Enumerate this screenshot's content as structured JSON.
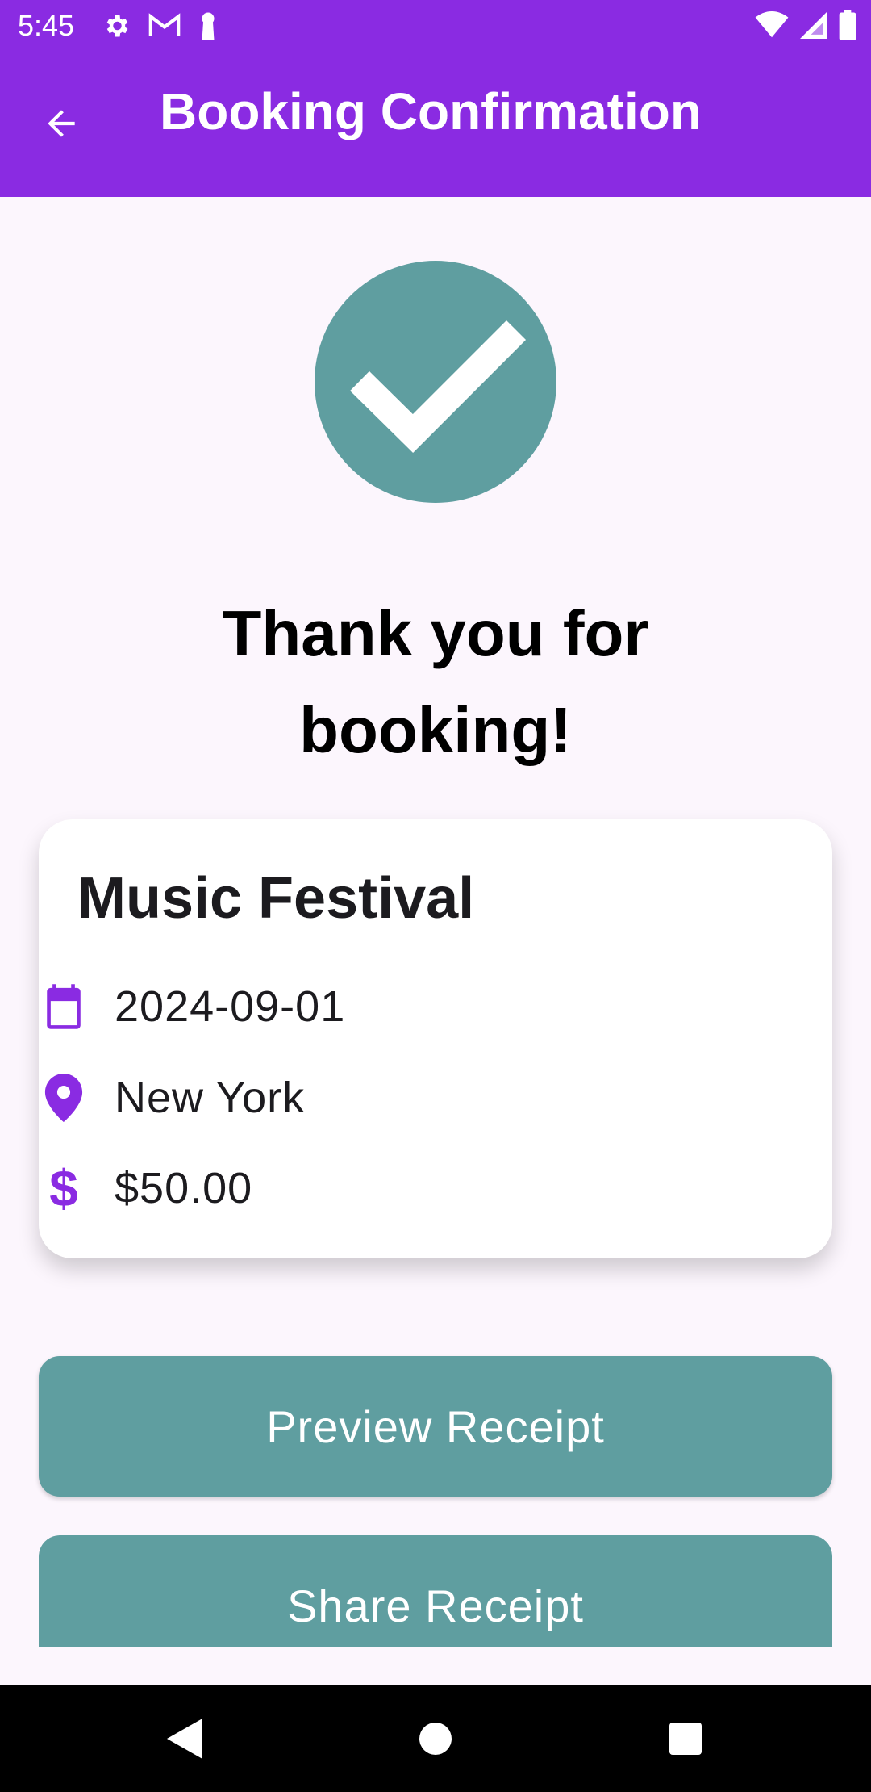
{
  "status_bar": {
    "time": "5:45",
    "left_icons": [
      "settings-icon",
      "gmail-icon",
      "keyhole-icon"
    ],
    "right_icons": [
      "wifi-icon",
      "signal-icon",
      "battery-icon"
    ]
  },
  "app_bar": {
    "title": "Booking Confirmation",
    "back_icon": "arrow-back-icon",
    "background": "#8A2BE2"
  },
  "success": {
    "icon": "check-icon",
    "color": "#5F9EA0"
  },
  "heading": {
    "line1": "Thank you for",
    "line2": "booking!"
  },
  "booking": {
    "event_name": "Music Festival",
    "date": "2024-09-01",
    "location": "New York",
    "price": "$50.00",
    "icon_color": "#8A2BE2"
  },
  "actions": {
    "preview_label": "Preview Receipt",
    "share_label": "Share Receipt",
    "button_color": "#5F9EA0"
  },
  "nav_bar": {
    "icons": [
      "nav-back-icon",
      "nav-home-icon",
      "nav-recents-icon"
    ]
  }
}
